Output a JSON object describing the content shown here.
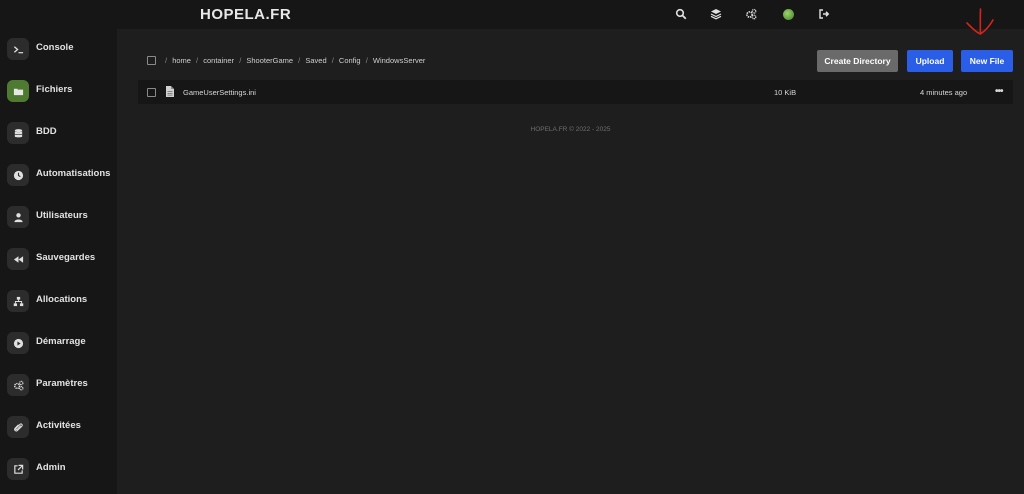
{
  "brand": "HOPELA.FR",
  "topbar": {
    "icons": [
      "search-icon",
      "layers-icon",
      "cogs-icon",
      "avatar-icon",
      "sign-out-icon"
    ]
  },
  "sidebar": {
    "items": [
      {
        "label": "Console",
        "icon": "terminal-icon",
        "active": false
      },
      {
        "label": "Fichiers",
        "icon": "folder-icon",
        "active": true
      },
      {
        "label": "BDD",
        "icon": "database-icon",
        "active": false
      },
      {
        "label": "Automatisations",
        "icon": "clock-icon",
        "active": false
      },
      {
        "label": "Utilisateurs",
        "icon": "user-icon",
        "active": false
      },
      {
        "label": "Sauvegardes",
        "icon": "backward-icon",
        "active": false
      },
      {
        "label": "Allocations",
        "icon": "network-icon",
        "active": false
      },
      {
        "label": "Démarrage",
        "icon": "play-icon",
        "active": false
      },
      {
        "label": "Paramètres",
        "icon": "cogs-icon",
        "active": false
      },
      {
        "label": "Activitées",
        "icon": "paperclip-icon",
        "active": false
      },
      {
        "label": "Admin",
        "icon": "external-link-icon",
        "active": false
      }
    ]
  },
  "breadcrumb": {
    "parts": [
      "home",
      "container",
      "ShooterGame",
      "Saved",
      "Config",
      "WindowsServer"
    ],
    "separator": "/"
  },
  "actions": {
    "create_directory": "Create Directory",
    "upload": "Upload",
    "new_file": "New File"
  },
  "files": [
    {
      "name": "GameUserSettings.ini",
      "size": "10 KiB",
      "modified": "4 minutes ago",
      "menu": "•••"
    }
  ],
  "footer": "HOPELA.FR © 2022 - 2025",
  "colors": {
    "accent_green": "#4e7b31",
    "button_blue": "#2a5ee6",
    "button_gray": "#6a6a6a",
    "annotation_red": "#d8231c"
  }
}
